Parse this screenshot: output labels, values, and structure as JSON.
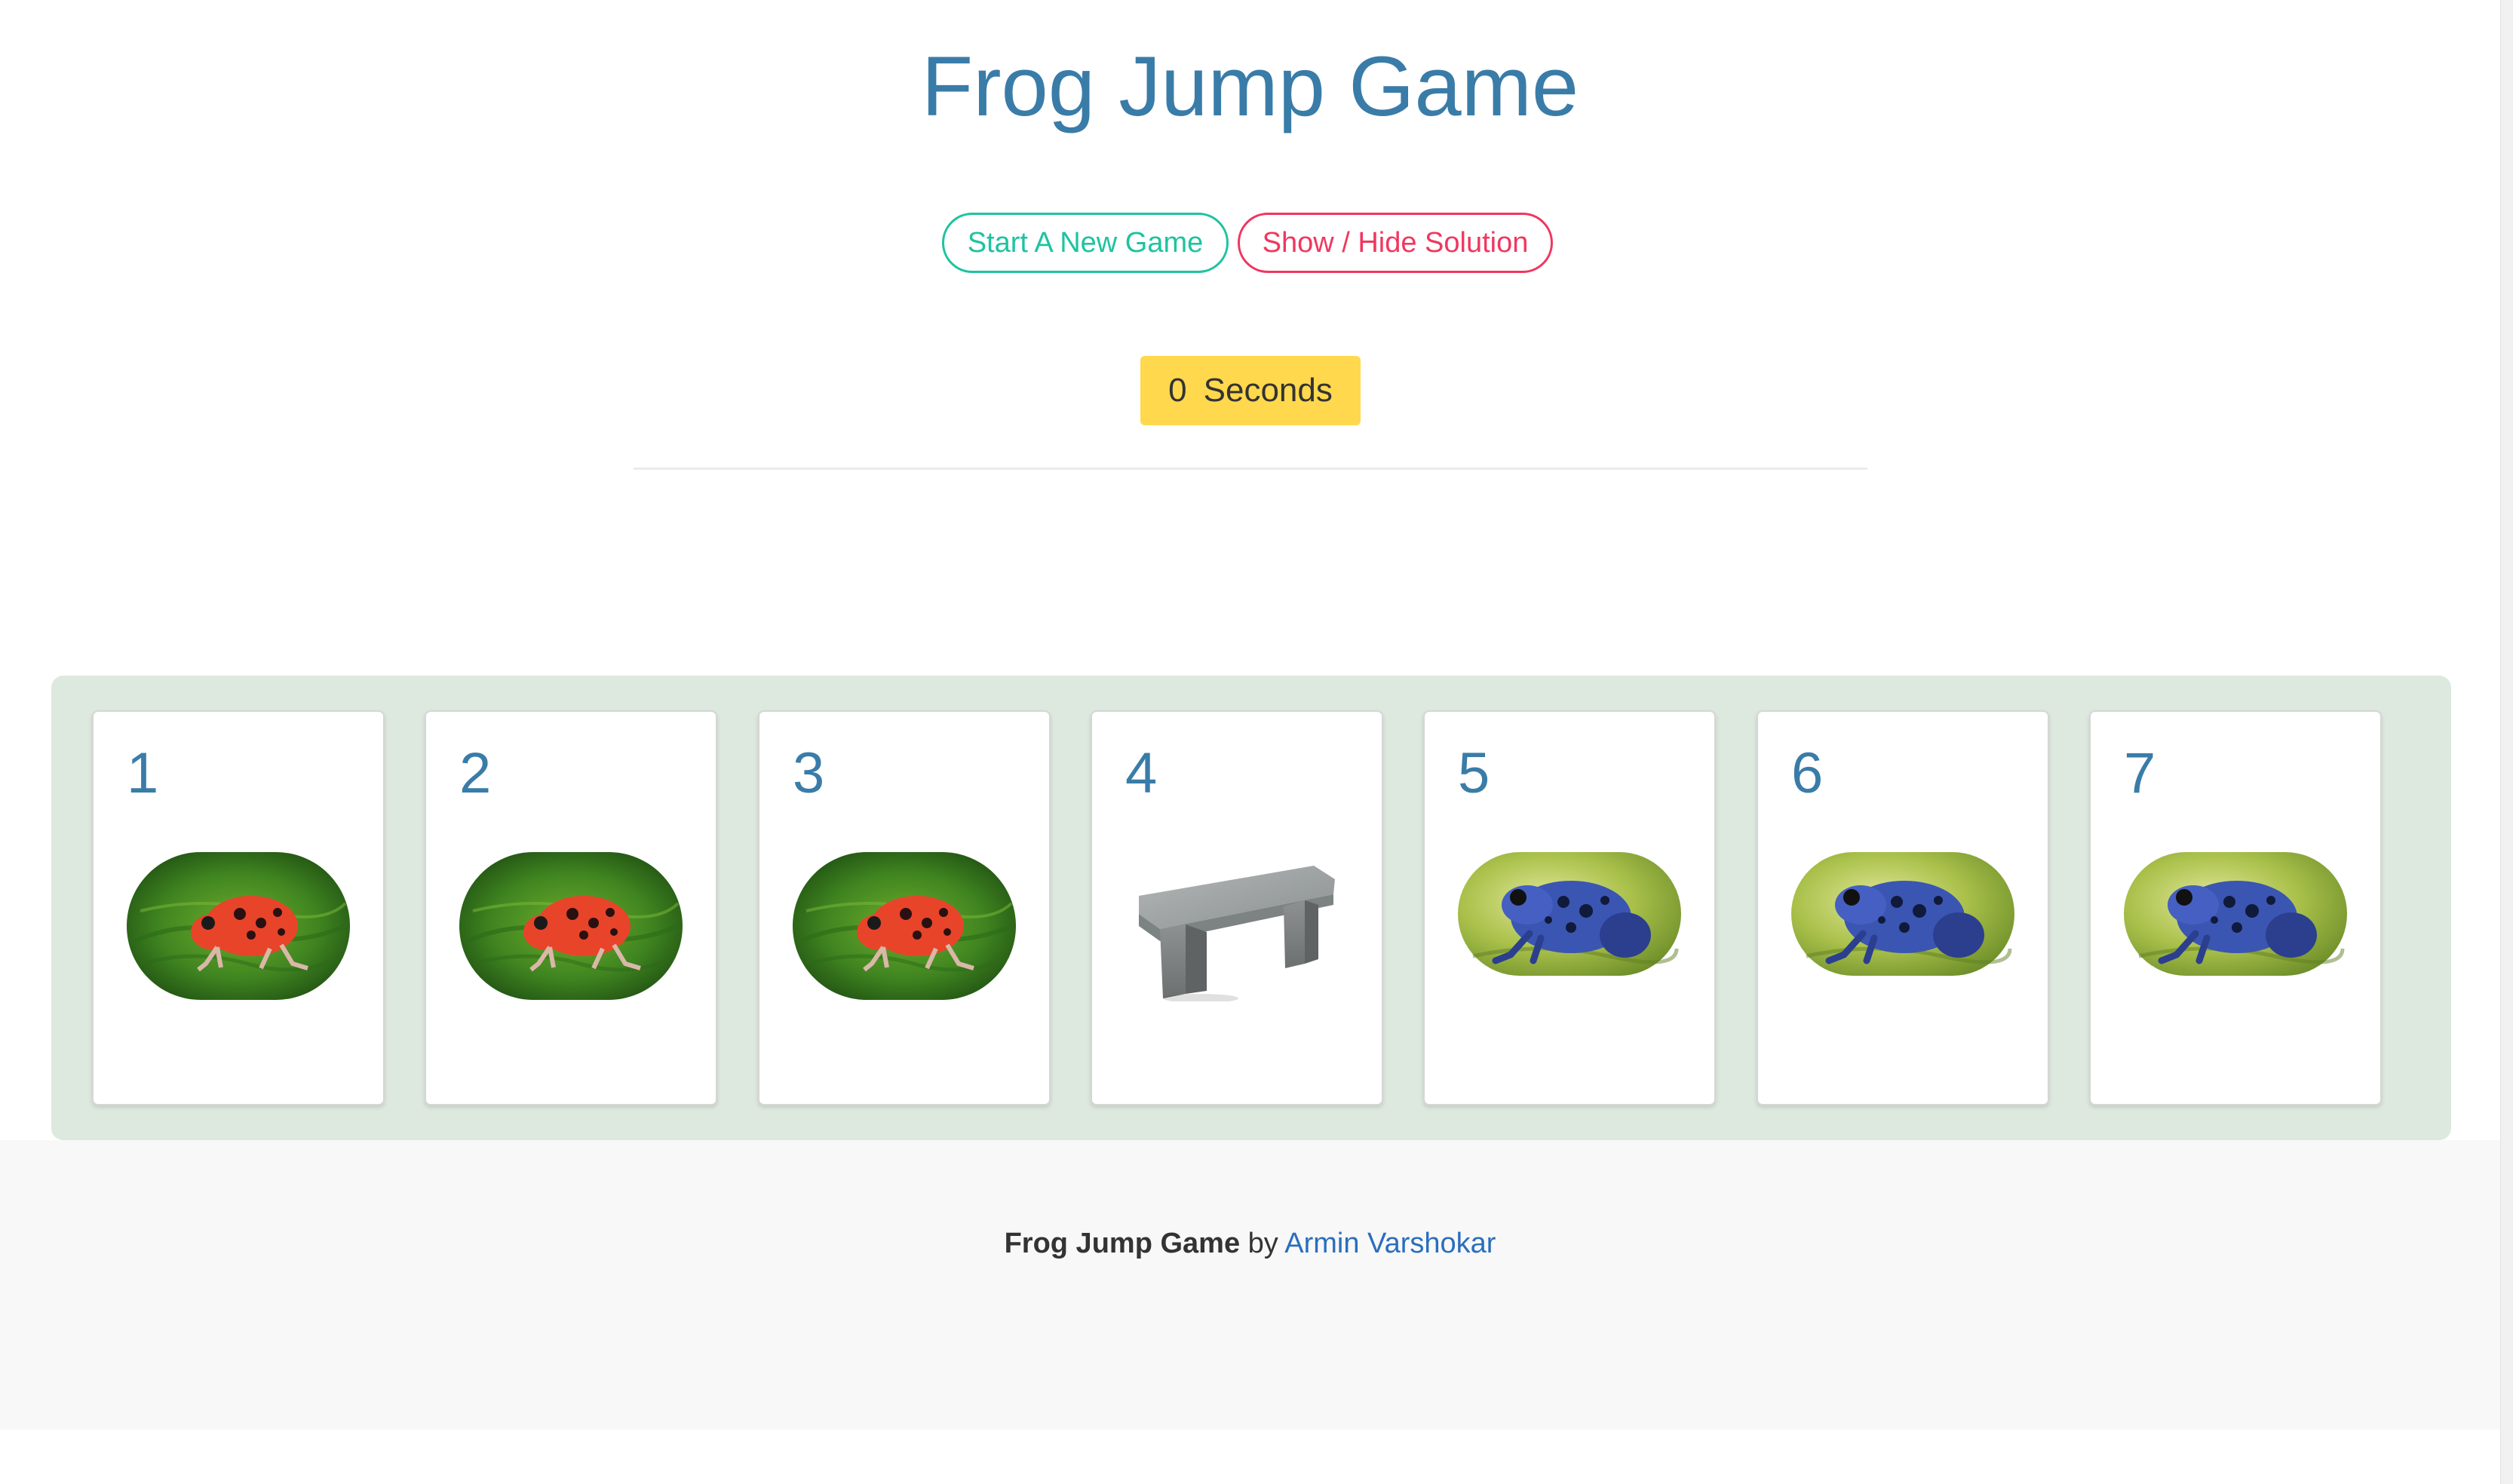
{
  "header": {
    "title": "Frog Jump Game"
  },
  "controls": {
    "new_game_label": "Start A New Game",
    "solution_label": "Show / Hide Solution"
  },
  "timer": {
    "value": "0",
    "unit": "Seconds"
  },
  "board": {
    "cells": [
      {
        "number": "1",
        "occupant": "red-frog"
      },
      {
        "number": "2",
        "occupant": "red-frog"
      },
      {
        "number": "3",
        "occupant": "red-frog"
      },
      {
        "number": "4",
        "occupant": "stone-bench"
      },
      {
        "number": "5",
        "occupant": "blue-frog"
      },
      {
        "number": "6",
        "occupant": "blue-frog"
      },
      {
        "number": "7",
        "occupant": "blue-frog"
      }
    ]
  },
  "footer": {
    "title": "Frog Jump Game",
    "by": "by",
    "author": "Armin Varshokar"
  },
  "colors": {
    "title": "#3a7ca8",
    "new_game": "#1ec3a0",
    "solution": "#f0375f",
    "timer_bg": "#ffd84d",
    "board_bg": "#dde9df",
    "link": "#2a6ebd"
  }
}
